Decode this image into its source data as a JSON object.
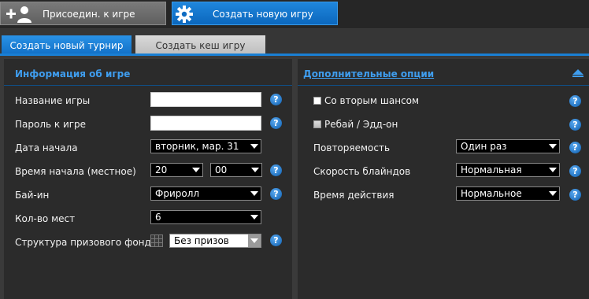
{
  "topbar": {
    "join_label": "Присоедин. к игре",
    "create_label": "Создать новую игру"
  },
  "tabs": [
    {
      "label": "Создать новый турнир",
      "active": true
    },
    {
      "label": "Создать кеш игру",
      "active": false
    }
  ],
  "game_info": {
    "title": "Информация об игре",
    "name_label": "Название игры",
    "name_value": "",
    "password_label": "Пароль к игре",
    "password_value": "",
    "start_date_label": "Дата начала",
    "start_date_value": "вторник, мар. 31",
    "start_time_label": "Время начала (местное)",
    "start_hour": "20",
    "start_minute": "00",
    "buyin_label": "Бай-ин",
    "buyin_value": "Фриролл",
    "seats_label": "Кол-во мест",
    "seats_value": "6",
    "prize_label": "Структура призового фонда",
    "prize_value": "Без призов"
  },
  "extra_options": {
    "title": "Дополнительные опции",
    "second_chance_label": "Со вторым шансом",
    "rebuy_label": "Ребай / Эдд-он",
    "repeat_label": "Повторяемость",
    "repeat_value": "Один раз",
    "blinds_label": "Скорость блайндов",
    "blinds_value": "Нормальная",
    "action_time_label": "Время действия",
    "action_time_value": "Нормальное"
  },
  "help_glyph": "?",
  "colors": {
    "accent": "#1a7fd4",
    "link": "#3f9dee",
    "panel": "#2b2b2b"
  }
}
